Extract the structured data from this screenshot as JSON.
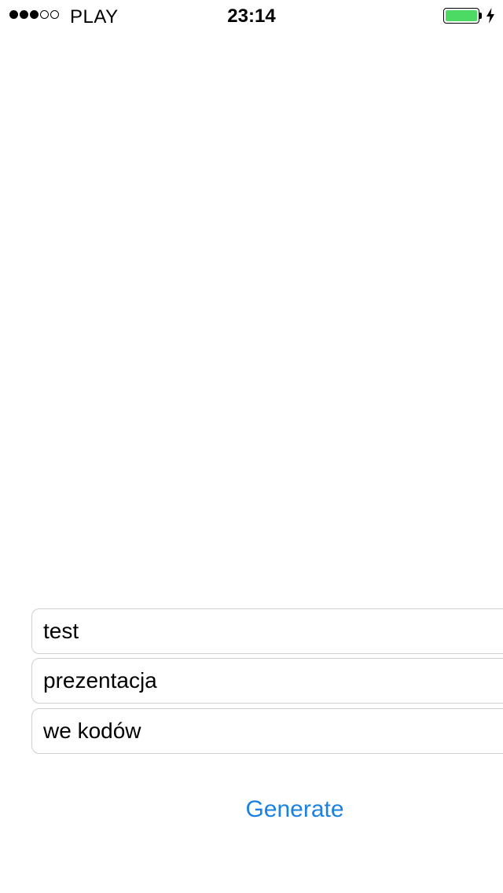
{
  "status_bar": {
    "signal_bars_filled": 3,
    "signal_bars_total": 5,
    "carrier": "PLAY",
    "time": "23:14",
    "battery_color": "#4cd964",
    "battery_level": 1.0,
    "charging": true
  },
  "form": {
    "field_1_value": "test",
    "field_2_value": "prezentacja",
    "field_3_value": "we kodów"
  },
  "actions": {
    "generate_label": "Generate",
    "generate_color": "#1a82e2"
  }
}
